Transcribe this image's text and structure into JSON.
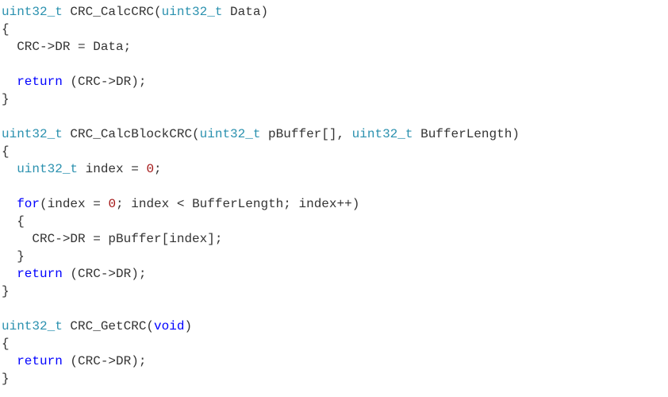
{
  "code": {
    "COLOR_KW": "#0000ff",
    "COLOR_TYPE": "#2b91af",
    "COLOR_NUM": "#a31515",
    "COLOR_PLAIN": "#333333",
    "lines": {
      "l01_a": "uint32_t",
      "l01_b": " CRC_CalcCRC(",
      "l01_c": "uint32_t",
      "l01_d": " Data)",
      "l02": "{",
      "l03": "  CRC->DR = Data;",
      "l04": "",
      "l05_a": "  ",
      "l05_b": "return",
      "l05_c": " (CRC->DR);",
      "l06": "}",
      "l07": "",
      "l08_a": "uint32_t",
      "l08_b": " CRC_CalcBlockCRC(",
      "l08_c": "uint32_t",
      "l08_d": " pBuffer[], ",
      "l08_e": "uint32_t",
      "l08_f": " BufferLength)",
      "l09": "{",
      "l10_a": "  ",
      "l10_b": "uint32_t",
      "l10_c": " index = ",
      "l10_d": "0",
      "l10_e": ";",
      "l11": "",
      "l12_a": "  ",
      "l12_b": "for",
      "l12_c": "(index = ",
      "l12_d": "0",
      "l12_e": "; index < BufferLength; index++)",
      "l13": "  {",
      "l14": "    CRC->DR = pBuffer[index];",
      "l15": "  }",
      "l16_a": "  ",
      "l16_b": "return",
      "l16_c": " (CRC->DR);",
      "l17": "}",
      "l18": "",
      "l19_a": "uint32_t",
      "l19_b": " CRC_GetCRC(",
      "l19_c": "void",
      "l19_d": ")",
      "l20": "{",
      "l21_a": "  ",
      "l21_b": "return",
      "l21_c": " (CRC->DR);",
      "l22": "}"
    }
  }
}
